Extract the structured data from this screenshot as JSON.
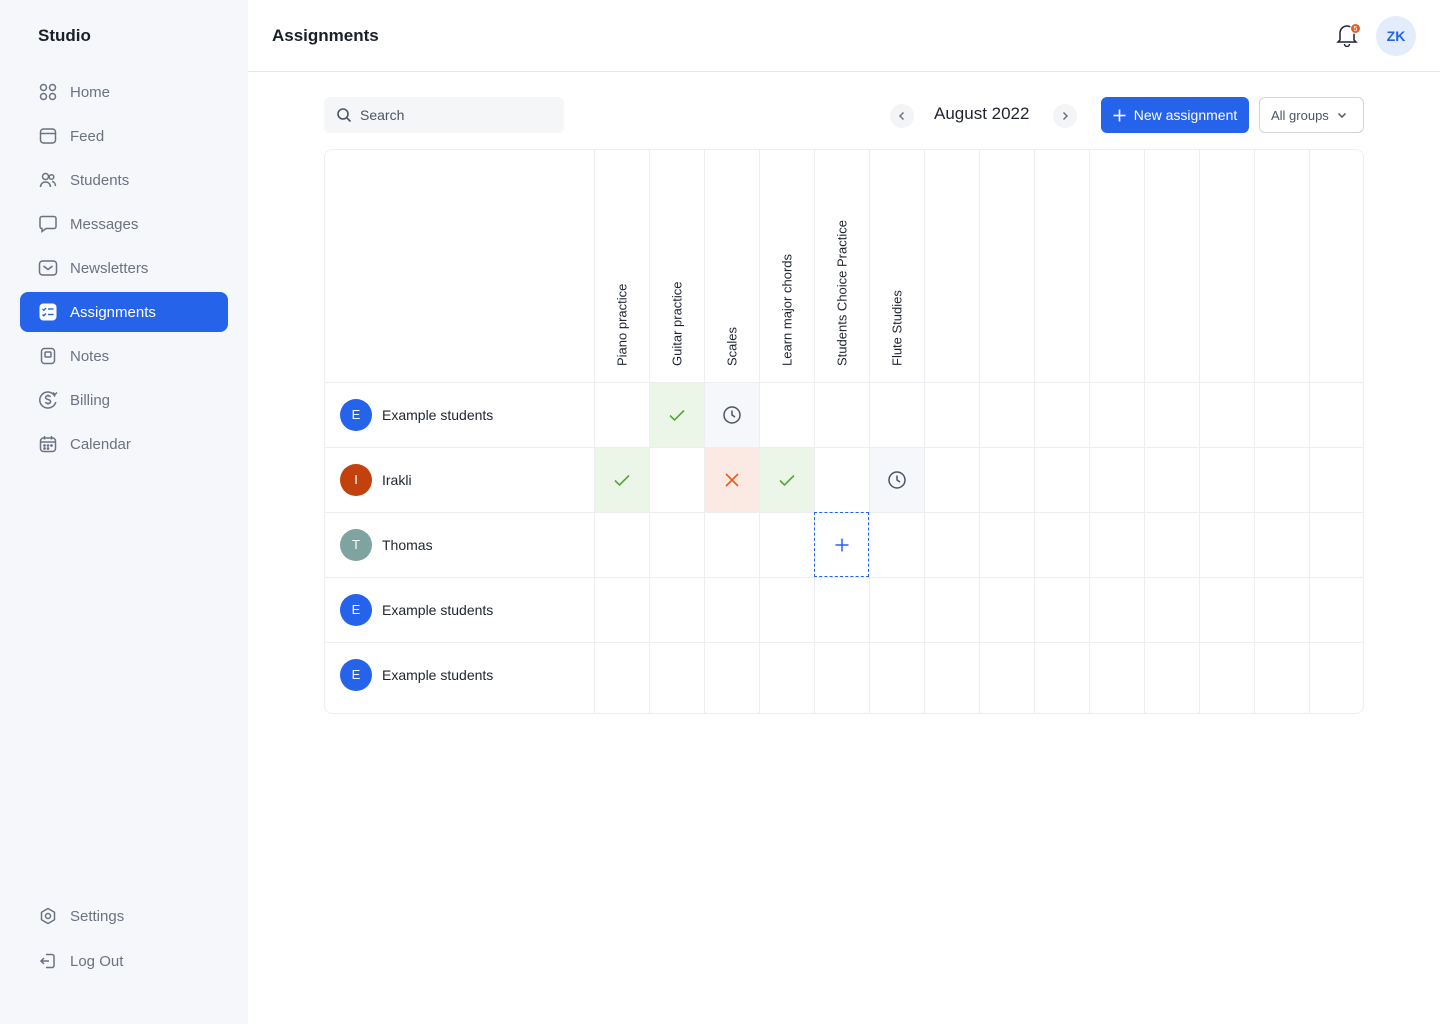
{
  "app": {
    "brand": "Studio"
  },
  "sidebar": {
    "items": [
      {
        "label": "Home",
        "icon": "grid-icon",
        "active": false
      },
      {
        "label": "Feed",
        "icon": "feed-icon",
        "active": false
      },
      {
        "label": "Students",
        "icon": "users-icon",
        "active": false
      },
      {
        "label": "Messages",
        "icon": "chat-icon",
        "active": false
      },
      {
        "label": "Newsletters",
        "icon": "mail-icon",
        "active": false
      },
      {
        "label": "Assignments",
        "icon": "checklist-icon",
        "active": true
      },
      {
        "label": "Notes",
        "icon": "note-icon",
        "active": false
      },
      {
        "label": "Billing",
        "icon": "dollar-icon",
        "active": false
      },
      {
        "label": "Calendar",
        "icon": "calendar-icon",
        "active": false
      }
    ],
    "bottom": [
      {
        "label": "Settings",
        "icon": "settings-icon"
      },
      {
        "label": "Log Out",
        "icon": "logout-icon"
      }
    ]
  },
  "header": {
    "title": "Assignments",
    "notification_count": "5",
    "user_initials": "ZK"
  },
  "toolbar": {
    "search_placeholder": "Search",
    "month": "August 2022",
    "new_label": "New assignment",
    "group_filter": "All groups"
  },
  "colors": {
    "accent": "#2563eb",
    "done_bg": "#ecf6e8",
    "done_mark": "#56a83a",
    "missed_bg": "#fbeae4",
    "missed_mark": "#e85d1f",
    "pending_bg": "#f5f7fa"
  },
  "assignments": [
    "Piano practice",
    "Guitar practice",
    "Scales",
    "Learn major chords",
    "Students Choice Practice",
    "Flute Studies"
  ],
  "students": [
    {
      "initial": "E",
      "name": "Example students",
      "avatar_color": "#2563eb",
      "status": [
        "",
        "done",
        "pending",
        "",
        "",
        ""
      ]
    },
    {
      "initial": "I",
      "name": "Irakli",
      "avatar_color": "#c2410c",
      "status": [
        "done",
        "",
        "missed",
        "done",
        "",
        "pending"
      ]
    },
    {
      "initial": "T",
      "name": "Thomas",
      "avatar_color": "#7fa3a0",
      "status": [
        "",
        "",
        "",
        "",
        "add",
        ""
      ]
    },
    {
      "initial": "E",
      "name": "Example students",
      "avatar_color": "#2563eb",
      "status": [
        "",
        "",
        "",
        "",
        "",
        ""
      ]
    },
    {
      "initial": "E",
      "name": "Example students",
      "avatar_color": "#2563eb",
      "status": [
        "",
        "",
        "",
        "",
        "",
        ""
      ]
    }
  ]
}
